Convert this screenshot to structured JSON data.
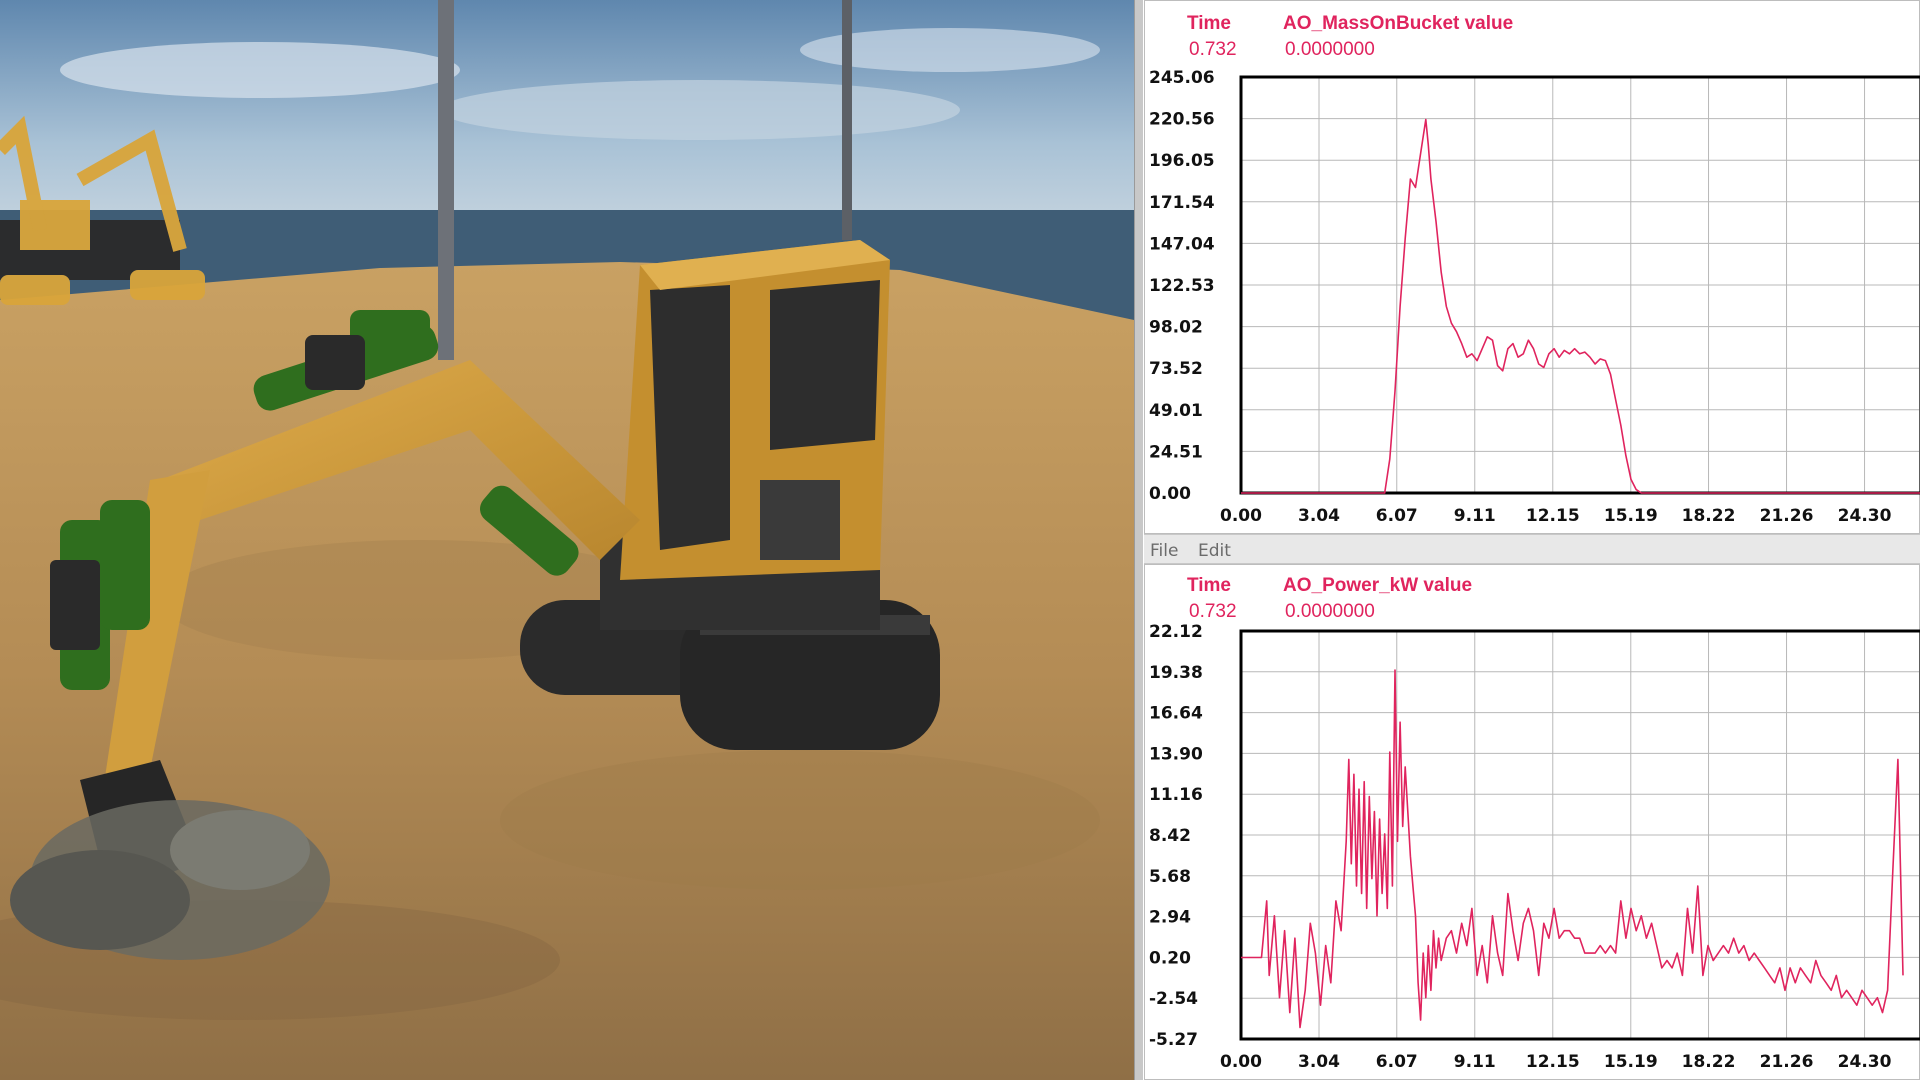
{
  "menu": {
    "file": "File",
    "edit": "Edit"
  },
  "colors": {
    "trace": "#e0245e",
    "grid": "#b8b8b8",
    "frame": "#000000"
  },
  "plots": [
    {
      "time_label": "Time",
      "time_value": "0.732",
      "signal_label": "AO_MassOnBucket value",
      "signal_value": "0.0000000",
      "chart_data": {
        "type": "line",
        "ylim": [
          0,
          245.06
        ],
        "xlim": [
          0,
          26.5
        ],
        "y_ticks": [
          "245.06",
          "220.56",
          "196.05",
          "171.54",
          "147.04",
          "122.53",
          "98.02",
          "73.52",
          "49.01",
          "24.51",
          "0.00"
        ],
        "x_ticks": [
          "0.00",
          "3.04",
          "6.07",
          "9.11",
          "12.15",
          "15.19",
          "18.22",
          "21.26",
          "24.30"
        ],
        "grid": true,
        "series": [
          {
            "x": [
              0,
              5.6,
              5.8,
              6.0,
              6.2,
              6.4,
              6.6,
              6.8,
              7.0,
              7.1,
              7.2,
              7.3,
              7.4,
              7.6,
              7.8,
              8.0,
              8.2,
              8.4,
              8.6,
              8.8,
              9.0,
              9.2,
              9.4,
              9.6,
              9.8,
              10.0,
              10.2,
              10.4,
              10.6,
              10.8,
              11.0,
              11.2,
              11.4,
              11.6,
              11.8,
              12.0,
              12.2,
              12.4,
              12.6,
              12.8,
              13.0,
              13.2,
              13.4,
              13.6,
              13.8,
              14.0,
              14.2,
              14.4,
              14.6,
              14.8,
              15.0,
              15.2,
              15.4,
              15.6,
              26.5
            ],
            "y": [
              0,
              0,
              20,
              60,
              110,
              150,
              185,
              180,
              200,
              210,
              220,
              205,
              185,
              160,
              130,
              110,
              100,
              95,
              88,
              80,
              82,
              78,
              85,
              92,
              90,
              75,
              72,
              85,
              88,
              80,
              82,
              90,
              85,
              76,
              74,
              82,
              85,
              80,
              84,
              82,
              85,
              82,
              83,
              80,
              76,
              79,
              78,
              70,
              55,
              40,
              22,
              8,
              2,
              0,
              0
            ]
          }
        ]
      }
    },
    {
      "time_label": "Time",
      "time_value": "0.732",
      "signal_label": "AO_Power_kW value",
      "signal_value": "0.0000000",
      "chart_data": {
        "type": "line",
        "ylim": [
          -5.27,
          22.12
        ],
        "xlim": [
          0,
          26.5
        ],
        "y_ticks": [
          "22.12",
          "19.38",
          "16.64",
          "13.90",
          "11.16",
          "8.42",
          "5.68",
          "2.94",
          "0.20",
          "-2.54",
          "-5.27"
        ],
        "x_ticks": [
          "0.00",
          "3.04",
          "6.07",
          "9.11",
          "12.15",
          "15.19",
          "18.22",
          "21.26",
          "24.30"
        ],
        "grid": true,
        "series": [
          {
            "x": [
              0,
              0.8,
              1.0,
              1.1,
              1.3,
              1.5,
              1.7,
              1.9,
              2.1,
              2.3,
              2.5,
              2.7,
              2.9,
              3.1,
              3.3,
              3.5,
              3.7,
              3.9,
              4.1,
              4.2,
              4.3,
              4.4,
              4.5,
              4.6,
              4.7,
              4.8,
              4.9,
              5.0,
              5.1,
              5.2,
              5.3,
              5.4,
              5.5,
              5.6,
              5.7,
              5.8,
              5.9,
              6.0,
              6.1,
              6.2,
              6.3,
              6.4,
              6.5,
              6.6,
              6.7,
              6.8,
              6.9,
              7.0,
              7.1,
              7.2,
              7.3,
              7.4,
              7.5,
              7.6,
              7.7,
              7.8,
              8.0,
              8.2,
              8.4,
              8.6,
              8.8,
              9.0,
              9.2,
              9.4,
              9.6,
              9.8,
              10.0,
              10.2,
              10.4,
              10.6,
              10.8,
              11.0,
              11.2,
              11.4,
              11.6,
              11.8,
              12.0,
              12.2,
              12.4,
              12.6,
              12.8,
              13.0,
              13.2,
              13.4,
              13.6,
              13.8,
              14.0,
              14.2,
              14.4,
              14.6,
              14.8,
              15.0,
              15.2,
              15.4,
              15.6,
              15.8,
              16.0,
              16.2,
              16.4,
              16.6,
              16.8,
              17.0,
              17.2,
              17.4,
              17.6,
              17.8,
              18.0,
              18.2,
              18.4,
              18.6,
              18.8,
              19.0,
              19.2,
              19.4,
              19.6,
              19.8,
              20.0,
              20.2,
              20.4,
              20.6,
              20.8,
              21.0,
              21.2,
              21.4,
              21.6,
              21.8,
              22.0,
              22.2,
              22.4,
              22.6,
              22.8,
              23.0,
              23.2,
              23.4,
              23.6,
              23.8,
              24.0,
              24.2,
              24.4,
              24.6,
              24.8,
              25.0,
              25.2,
              25.4,
              25.6,
              25.8,
              26.0,
              26.2,
              26.4
            ],
            "y": [
              0.2,
              0.2,
              4.0,
              -1.0,
              3.0,
              -2.5,
              2.0,
              -3.5,
              1.5,
              -4.5,
              -2.0,
              2.5,
              0.5,
              -3.0,
              1.0,
              -1.5,
              4.0,
              2.0,
              8.0,
              13.5,
              6.5,
              12.5,
              5.0,
              11.5,
              4.5,
              12.0,
              3.5,
              11.0,
              5.5,
              10.0,
              3.0,
              9.5,
              4.5,
              8.5,
              3.5,
              14.0,
              5.0,
              19.5,
              8.0,
              16.0,
              9.0,
              13.0,
              10.0,
              7.0,
              5.0,
              3.0,
              -1.5,
              -4.0,
              0.5,
              -2.5,
              1.0,
              -2.0,
              2.0,
              -0.5,
              1.5,
              0.0,
              1.5,
              2.0,
              0.5,
              2.5,
              1.0,
              3.5,
              -1.0,
              1.0,
              -1.5,
              3.0,
              0.5,
              -1.0,
              4.5,
              2.0,
              0.0,
              2.5,
              3.5,
              2.0,
              -1.0,
              2.5,
              1.5,
              3.5,
              1.5,
              2.0,
              2.0,
              1.5,
              1.5,
              0.5,
              0.5,
              0.5,
              1.0,
              0.5,
              1.0,
              0.5,
              4.0,
              1.5,
              3.5,
              2.0,
              3.0,
              1.5,
              2.5,
              1.0,
              -0.5,
              0.0,
              -0.5,
              0.5,
              -1.0,
              3.5,
              0.5,
              5.0,
              -1.0,
              1.0,
              0.0,
              0.5,
              1.0,
              0.5,
              1.5,
              0.5,
              1.0,
              0.0,
              0.5,
              0.0,
              -0.5,
              -1.0,
              -1.5,
              -0.5,
              -2.0,
              -0.5,
              -1.5,
              -0.5,
              -1.0,
              -1.5,
              0.0,
              -1.0,
              -1.5,
              -2.0,
              -1.0,
              -2.5,
              -2.0,
              -2.5,
              -3.0,
              -2.0,
              -2.5,
              -3.0,
              -2.5,
              -3.5,
              -2.0,
              6.0,
              13.5,
              -1.0
            ]
          }
        ]
      }
    }
  ]
}
